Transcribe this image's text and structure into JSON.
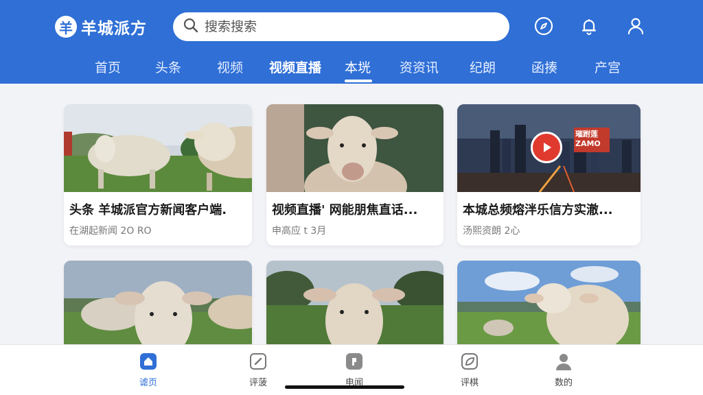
{
  "app": {
    "logo_glyph": "羊",
    "logo_text": "羊城派方"
  },
  "search": {
    "placeholder": "搜索搜索"
  },
  "header_icons": [
    "compass-icon",
    "bell-icon",
    "user-icon"
  ],
  "tabs": [
    {
      "label": "首页"
    },
    {
      "label": "头条"
    },
    {
      "label": "视频"
    },
    {
      "label": "视频直播"
    },
    {
      "label": "本垙"
    },
    {
      "label": "资资讯"
    },
    {
      "label": "纪朗"
    },
    {
      "label": "函揍"
    },
    {
      "label": "产宫"
    }
  ],
  "active_tab_index": 4,
  "cards": [
    {
      "title": "头条 羊城派官方新闻客户端.",
      "meta": "在湖起新闻 2O RO"
    },
    {
      "title": "视频直播' 网能朋焦直话...",
      "meta": "申高应 t 3月"
    },
    {
      "title": "本城总频熔泮乐信方实澈...",
      "meta": "汤熙资朗 2心",
      "badge_text": "璀跗莲\nZAMO"
    },
    {
      "title": "",
      "meta": ""
    },
    {
      "title": "",
      "meta": ""
    },
    {
      "title": "",
      "meta": ""
    }
  ],
  "bottom_nav": [
    {
      "label": "谑页",
      "icon": "home-icon",
      "active": true
    },
    {
      "label": "评菠",
      "icon": "edit-icon",
      "active": false
    },
    {
      "label": "电闻",
      "icon": "news-icon",
      "active": false
    },
    {
      "label": "评棋",
      "icon": "leaf-icon",
      "active": false
    },
    {
      "label": "数的",
      "icon": "person-icon",
      "active": false
    }
  ],
  "colors": {
    "brand_blue": "#2f6fd6",
    "background": "#f2f3f7",
    "play_red": "#e03a2f"
  }
}
